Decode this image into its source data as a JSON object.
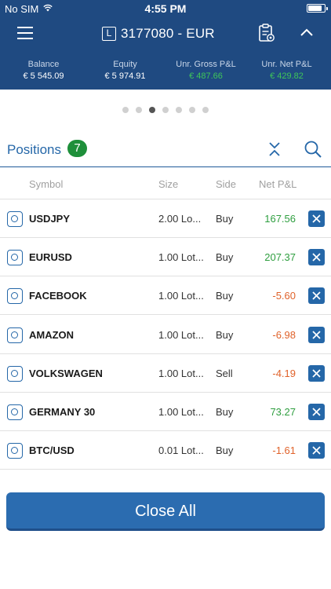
{
  "status_bar": {
    "carrier": "No SIM",
    "time": "4:55 PM"
  },
  "header": {
    "account_badge": "L",
    "account_label": "3177080 - EUR",
    "icons": [
      "menu-icon",
      "clipboard-settings-icon",
      "chevron-up-icon"
    ]
  },
  "metrics": [
    {
      "label": "Balance",
      "value": "€ 5 545.09",
      "tone": "neutral"
    },
    {
      "label": "Equity",
      "value": "€ 5 974.91",
      "tone": "neutral"
    },
    {
      "label": "Unr. Gross P&L",
      "value": "€ 487.66",
      "tone": "positive"
    },
    {
      "label": "Unr. Net P&L",
      "value": "€ 429.82",
      "tone": "positive"
    }
  ],
  "pager": {
    "count": 7,
    "active_index": 2
  },
  "positions": {
    "title": "Positions",
    "count": "7"
  },
  "table": {
    "columns": {
      "symbol": "Symbol",
      "size": "Size",
      "side": "Side",
      "pnl": "Net P&L"
    },
    "rows": [
      {
        "symbol": "USDJPY",
        "size": "2.00 Lo...",
        "side": "Buy",
        "pnl": "167.56",
        "tone": "positive"
      },
      {
        "symbol": "EURUSD",
        "size": "1.00 Lot...",
        "side": "Buy",
        "pnl": "207.37",
        "tone": "positive"
      },
      {
        "symbol": "FACEBOOK",
        "size": "1.00 Lot...",
        "side": "Buy",
        "pnl": "-5.60",
        "tone": "negative"
      },
      {
        "symbol": "AMAZON",
        "size": "1.00 Lot...",
        "side": "Buy",
        "pnl": "-6.98",
        "tone": "negative"
      },
      {
        "symbol": "VOLKSWAGEN",
        "size": "1.00 Lot...",
        "side": "Sell",
        "pnl": "-4.19",
        "tone": "negative"
      },
      {
        "symbol": "GERMANY 30",
        "size": "1.00 Lot...",
        "side": "Buy",
        "pnl": "73.27",
        "tone": "positive"
      },
      {
        "symbol": "BTC/USD",
        "size": "0.01 Lot...",
        "side": "Buy",
        "pnl": "-1.61",
        "tone": "negative"
      }
    ]
  },
  "close_all_label": "Close All",
  "colors": {
    "header_bg": "#1f4a81",
    "accent": "#2567a8",
    "positive": "#2e9e3f",
    "negative": "#e0622a",
    "badge": "#1e8f3a"
  }
}
